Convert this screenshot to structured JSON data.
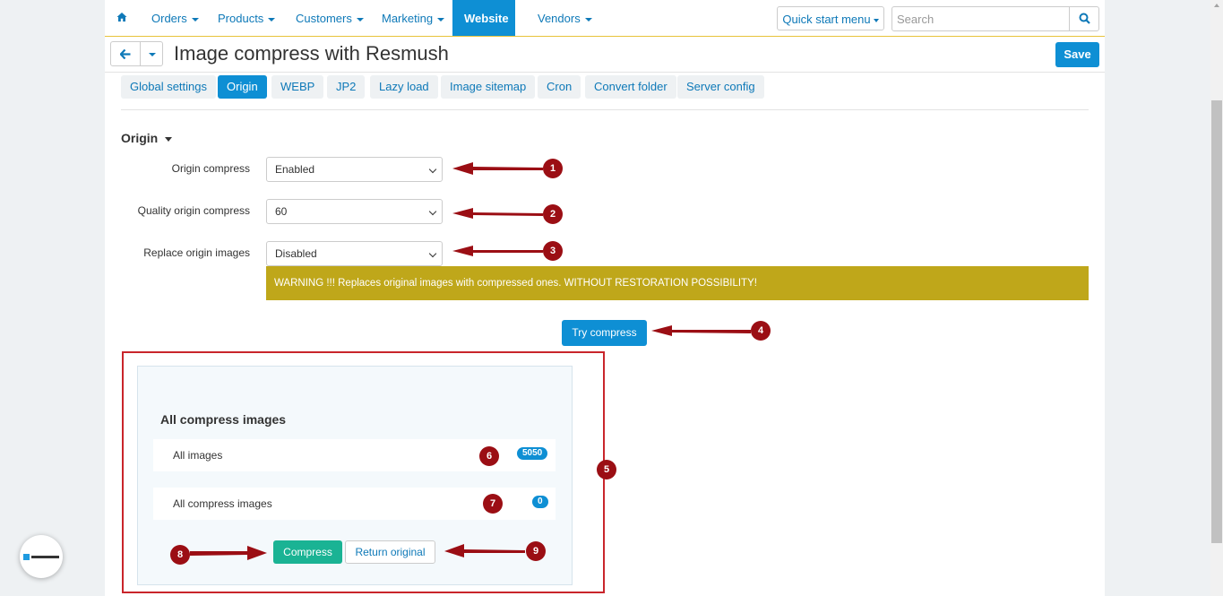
{
  "nav": {
    "items": [
      {
        "label": "Orders"
      },
      {
        "label": "Products"
      },
      {
        "label": "Customers"
      },
      {
        "label": "Marketing"
      },
      {
        "label": "Website",
        "active": true
      },
      {
        "label": "Vendors"
      }
    ],
    "quick_start": "Quick start menu",
    "search_placeholder": "Search"
  },
  "header": {
    "title": "Image compress with Resmush",
    "save_label": "Save"
  },
  "tabs": [
    {
      "label": "Global settings"
    },
    {
      "label": "Origin",
      "active": true
    },
    {
      "label": "WEBP"
    },
    {
      "label": "JP2"
    },
    {
      "label": "Lazy load"
    },
    {
      "label": "Image sitemap"
    },
    {
      "label": "Cron"
    },
    {
      "label": "Convert folder"
    },
    {
      "label": "Server config"
    }
  ],
  "section": {
    "title": "Origin",
    "fields": [
      {
        "label": "Origin compress",
        "value": "Enabled"
      },
      {
        "label": "Quality origin compress",
        "value": "60"
      },
      {
        "label": "Replace origin images",
        "value": "Disabled"
      }
    ],
    "warning": "WARNING !!! Replaces original images with compressed ones. WITHOUT RESTORATION POSSIBILITY!",
    "try_label": "Try compress"
  },
  "stats": {
    "title": "All compress images",
    "rows": [
      {
        "label": "All images",
        "count": "5050"
      },
      {
        "label": "All compress images",
        "count": "0"
      }
    ],
    "compress_label": "Compress",
    "return_label": "Return original"
  },
  "annotations": [
    "1",
    "2",
    "3",
    "4",
    "5",
    "6",
    "7",
    "8",
    "9"
  ],
  "colors": {
    "accent": "#0e8fd4",
    "link": "#0e79b8",
    "warning_bg": "#bfa71a",
    "success": "#1ab394",
    "annotation": "#9b0e14",
    "frame": "#c9252b"
  }
}
